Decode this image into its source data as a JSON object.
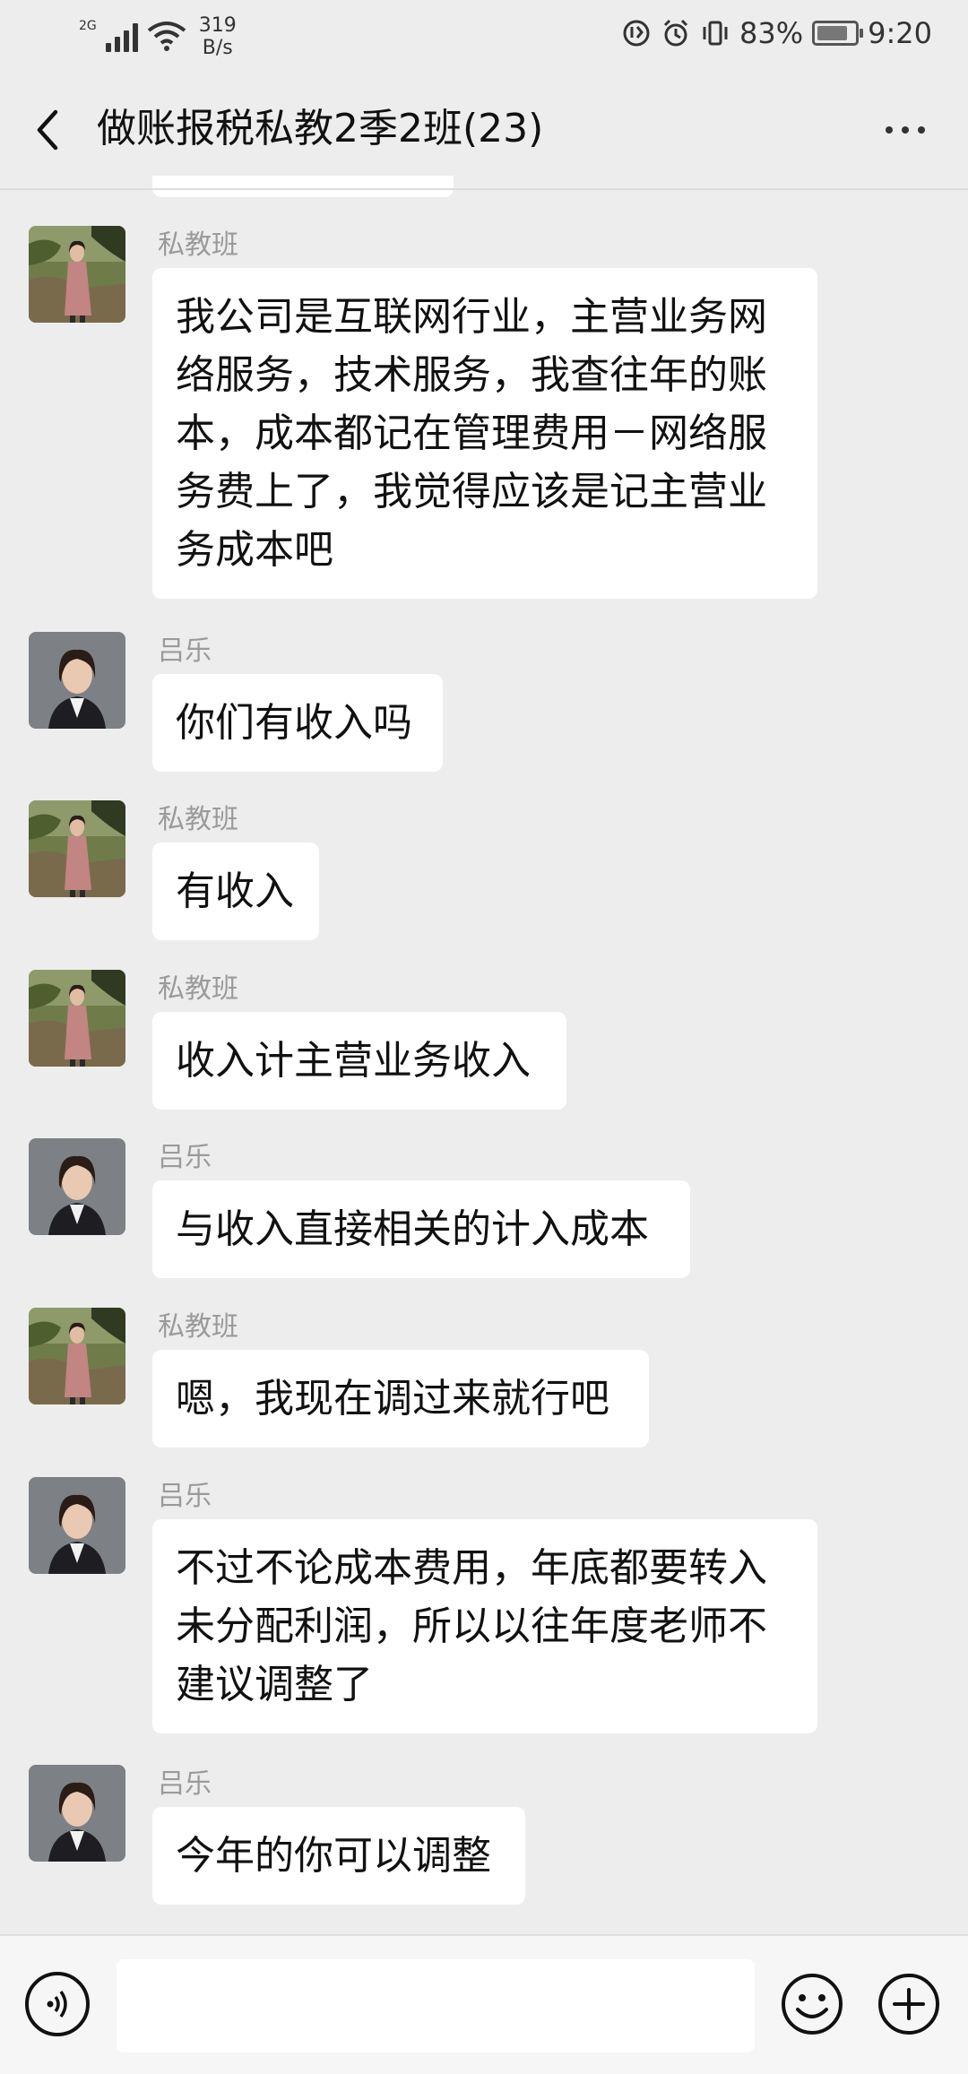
{
  "status_bar": {
    "network": "2G",
    "speed_value": "319",
    "speed_unit": "B/s",
    "battery": "83%",
    "battery_level": 0.83,
    "time": "9:20"
  },
  "header": {
    "back_icon": "chevron-left-icon",
    "title": "做账报税私教2季2班(23)",
    "more_icon": "more-dots-icon"
  },
  "messages": [
    {
      "sender": "私教班",
      "avatar": "avatar-sijiaoban",
      "text": "我公司是互联网行业，主营业务网络服务，技术服务，我查往年的账本，成本都记在管理费用－网络服务费上了，我觉得应该是记主营业务成本吧"
    },
    {
      "sender": "吕乐",
      "avatar": "avatar-lyule",
      "text": "你们有收入吗"
    },
    {
      "sender": "私教班",
      "avatar": "avatar-sijiaoban",
      "text": "有收入"
    },
    {
      "sender": "私教班",
      "avatar": "avatar-sijiaoban",
      "text": "收入计主营业务收入"
    },
    {
      "sender": "吕乐",
      "avatar": "avatar-lyule",
      "text": "与收入直接相关的计入成本"
    },
    {
      "sender": "私教班",
      "avatar": "avatar-sijiaoban",
      "text": "嗯，我现在调过来就行吧"
    },
    {
      "sender": "吕乐",
      "avatar": "avatar-lyule",
      "text": "不过不论成本费用，年底都要转入未分配利润，所以以往年度老师不建议调整了"
    },
    {
      "sender": "吕乐",
      "avatar": "avatar-lyule",
      "text": "今年的你可以调整"
    }
  ],
  "input_bar": {
    "voice_icon": "voice-icon",
    "input_value": "",
    "emoji_icon": "emoji-icon",
    "plus_icon": "plus-icon"
  }
}
